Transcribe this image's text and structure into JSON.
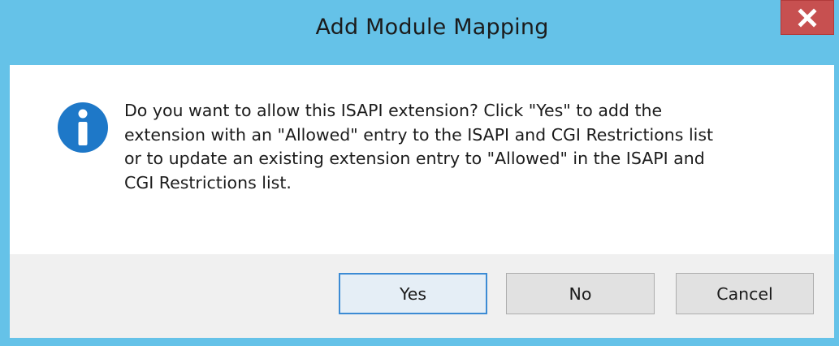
{
  "window": {
    "title": "Add Module Mapping",
    "close_label": "x",
    "accent_color": "#65c2e8",
    "close_color": "#c75050"
  },
  "dialog": {
    "icon": "info-icon",
    "icon_color": "#1e78c8",
    "message": "Do you want to allow this ISAPI extension? Click \"Yes\" to add the\nextension with an \"Allowed\" entry to the ISAPI and CGI Restrictions list\nor to update an existing extension entry to \"Allowed\" in the ISAPI and\nCGI Restrictions list."
  },
  "buttons": {
    "yes": "Yes",
    "no": "No",
    "cancel": "Cancel"
  }
}
